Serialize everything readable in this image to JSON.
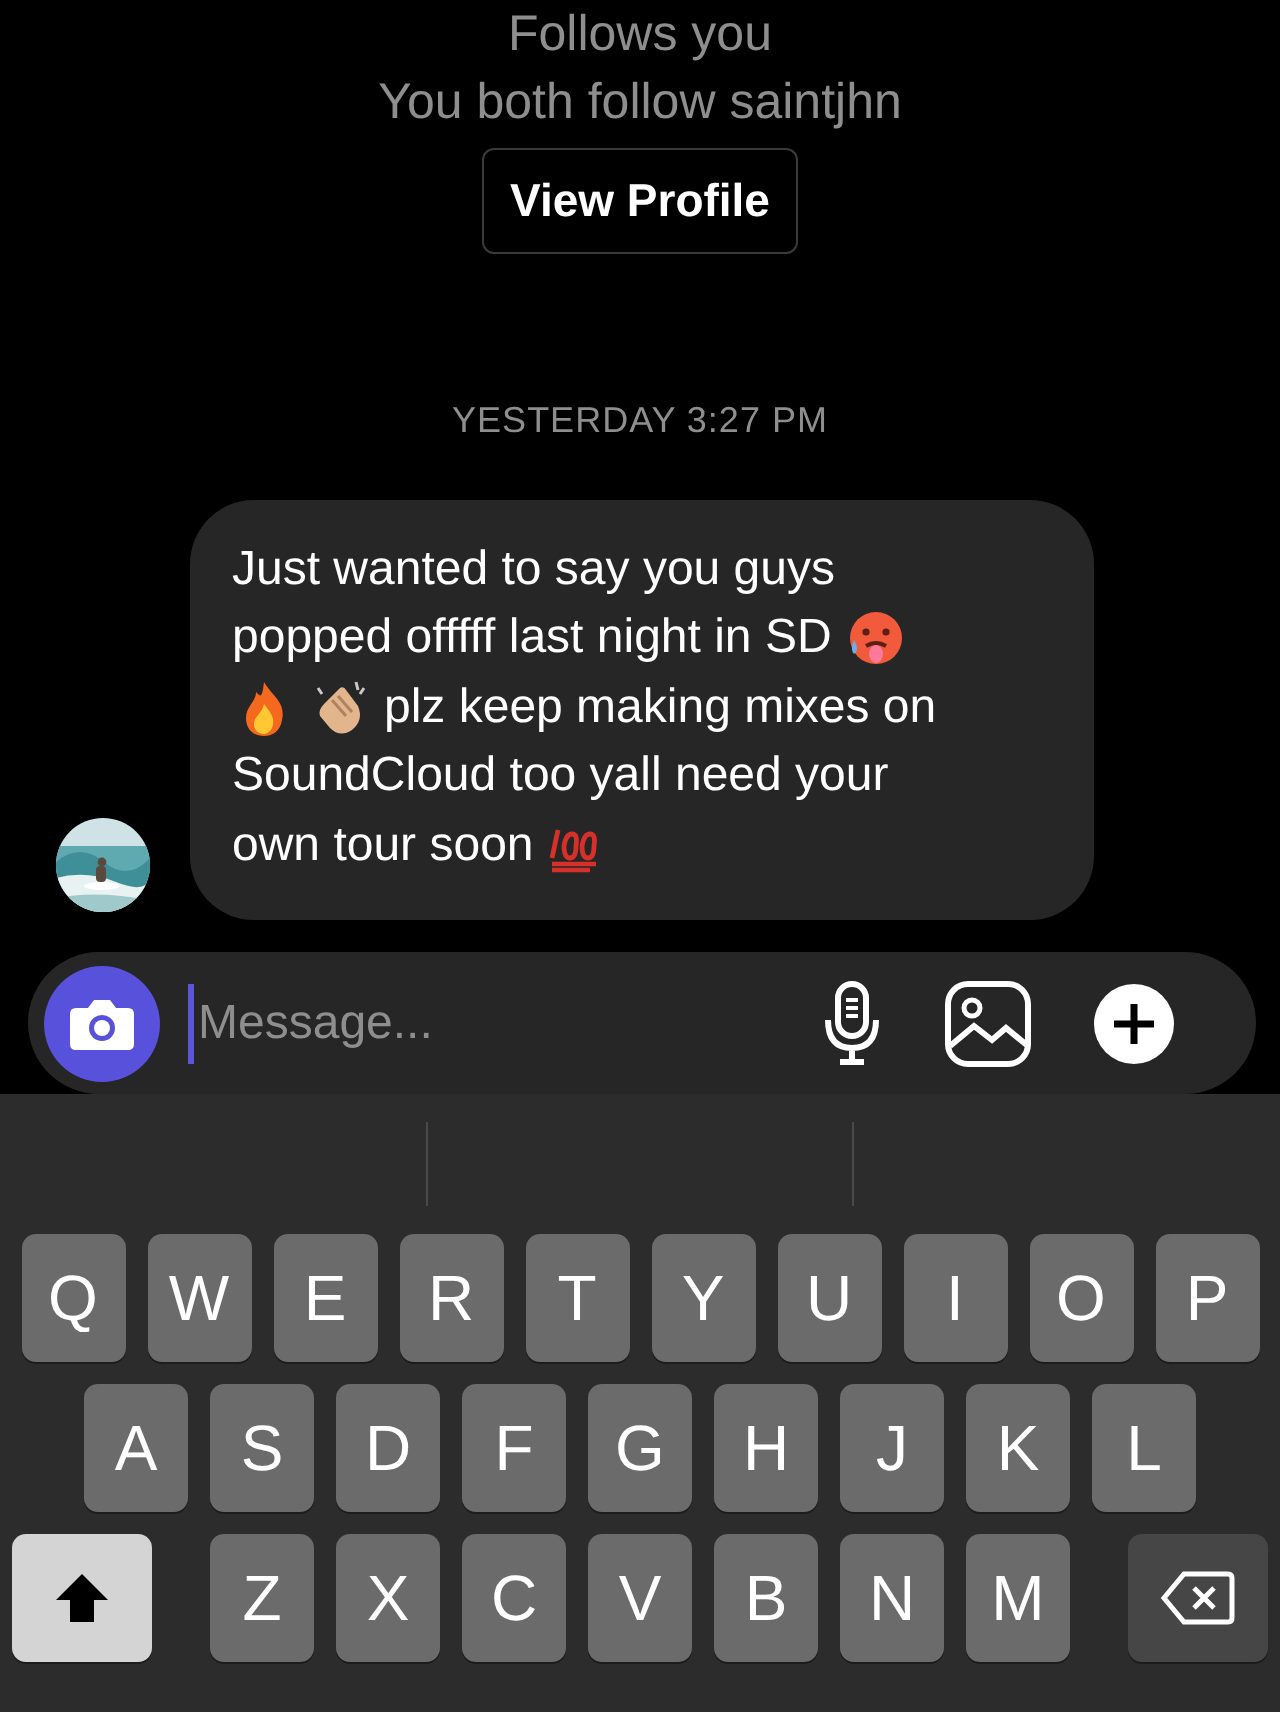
{
  "profile_info": [
    "Follows you",
    "You both follow saintjhn"
  ],
  "view_profile_button": "View Profile",
  "timestamp": "YESTERDAY 3:27 PM",
  "message": {
    "avatar": {
      "kind": "picture"
    },
    "lines": [
      [
        {
          "kind": "text",
          "text": "Just wanted to say you guys"
        }
      ],
      [
        {
          "kind": "text",
          "text": "popped offfff last night in SD"
        },
        {
          "kind": "hotface"
        }
      ],
      [
        {
          "kind": "fire"
        },
        {
          "kind": "clap"
        },
        {
          "kind": "text",
          "text": "plz keep making mixes on"
        }
      ],
      [
        {
          "kind": "text",
          "text": "SoundCloud too yall need your"
        }
      ],
      [
        {
          "kind": "text",
          "text": "own tour soon"
        },
        {
          "kind": "hundred"
        }
      ]
    ]
  },
  "composer": {
    "placeholder": "Message..."
  },
  "keyboard": {
    "rows": [
      [
        {
          "kind": "letter",
          "label": "Q"
        },
        {
          "kind": "letter",
          "label": "W"
        },
        {
          "kind": "letter",
          "label": "E"
        },
        {
          "kind": "letter",
          "label": "R"
        },
        {
          "kind": "letter",
          "label": "T"
        },
        {
          "kind": "letter",
          "label": "Y"
        },
        {
          "kind": "letter",
          "label": "U"
        },
        {
          "kind": "letter",
          "label": "I"
        },
        {
          "kind": "letter",
          "label": "O"
        },
        {
          "kind": "letter",
          "label": "P"
        }
      ],
      [
        {
          "kind": "letter",
          "label": "A"
        },
        {
          "kind": "letter",
          "label": "S"
        },
        {
          "kind": "letter",
          "label": "D"
        },
        {
          "kind": "letter",
          "label": "F"
        },
        {
          "kind": "letter",
          "label": "G"
        },
        {
          "kind": "letter",
          "label": "H"
        },
        {
          "kind": "letter",
          "label": "J"
        },
        {
          "kind": "letter",
          "label": "K"
        },
        {
          "kind": "letter",
          "label": "L"
        }
      ],
      [
        {
          "kind": "shift",
          "on": true
        },
        {
          "kind": "letter",
          "label": "Z"
        },
        {
          "kind": "letter",
          "label": "X"
        },
        {
          "kind": "letter",
          "label": "C"
        },
        {
          "kind": "letter",
          "label": "V"
        },
        {
          "kind": "letter",
          "label": "B"
        },
        {
          "kind": "letter",
          "label": "N"
        },
        {
          "kind": "letter",
          "label": "M"
        },
        {
          "kind": "backspace"
        }
      ]
    ]
  }
}
